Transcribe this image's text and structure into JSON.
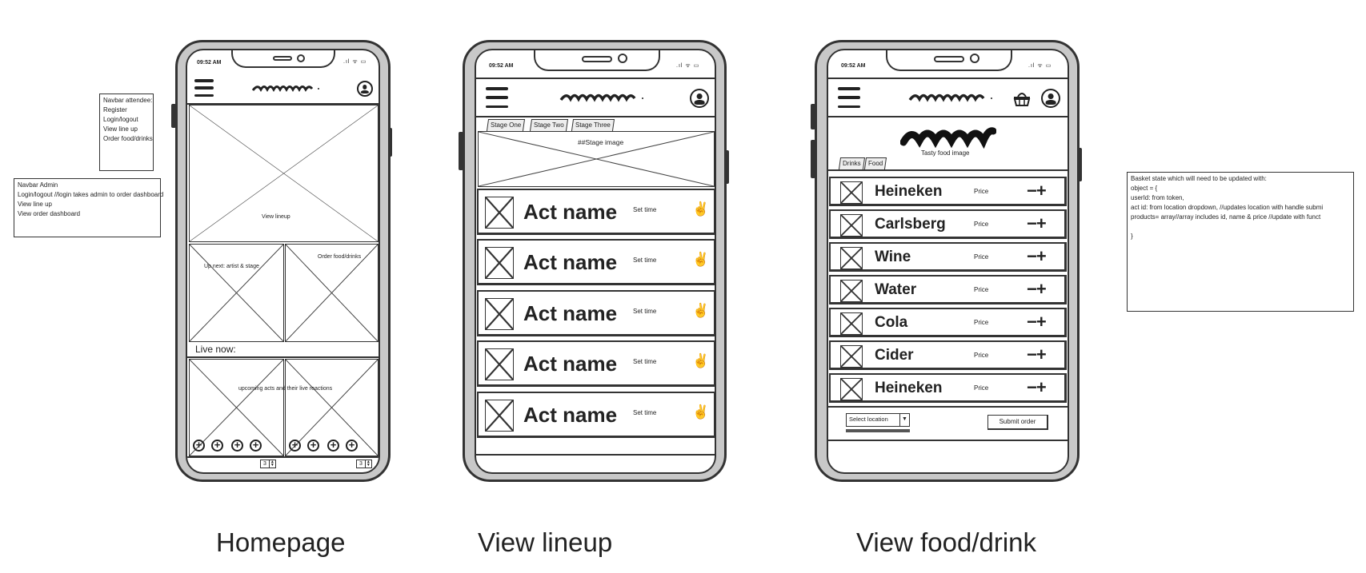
{
  "notes": {
    "navbar_attendee": [
      "Navbar attendee:",
      "Register",
      "Login/logout",
      "View line up",
      "Order food/drinks"
    ],
    "navbar_admin": [
      "Navbar Admin",
      "Login/logout //login takes admin to order dashboard",
      "View line up",
      "View order dashboard"
    ],
    "basket": [
      "Basket state which will need to be updated with:",
      "object = {",
      "userId: from token,",
      "act id: from location dropdown, //updates location with handle submi",
      "products= array//array includes id, name & price //update with funct",
      "",
      "}"
    ]
  },
  "status": {
    "time": "09:52 AM",
    "icons": ".ıl ᯤ ▭"
  },
  "homepage": {
    "caption": "Homepage",
    "hero_label": "View lineup",
    "upnext_label": "Up next: artist & stage",
    "order_label": "Order food/drinks",
    "live_now": "Live now:",
    "live_label": "upcoming acts and their live reactions",
    "plus": "+",
    "stepper_value": "3"
  },
  "lineup": {
    "caption": "View lineup",
    "tabs": [
      "Stage One",
      "Stage Two",
      "Stage Three"
    ],
    "stage_image": "##Stage image",
    "acts": [
      {
        "name": "Act name",
        "time": "Set time"
      },
      {
        "name": "Act name",
        "time": "Set time"
      },
      {
        "name": "Act name",
        "time": "Set time"
      },
      {
        "name": "Act name",
        "time": "Set time"
      },
      {
        "name": "Act name",
        "time": "Set time"
      }
    ],
    "reaction_icon": "✌"
  },
  "food": {
    "caption": "View food/drink",
    "hero_text": "Tasty food image",
    "tabs": [
      "Drinks",
      "Food"
    ],
    "items": [
      {
        "name": "Heineken",
        "price": "Price"
      },
      {
        "name": "Carlsberg",
        "price": "Price"
      },
      {
        "name": "Wine",
        "price": "Price"
      },
      {
        "name": "Water",
        "price": "Price"
      },
      {
        "name": "Cola",
        "price": "Price"
      },
      {
        "name": "Cider",
        "price": "Price"
      },
      {
        "name": "Heineken",
        "price": "Price"
      }
    ],
    "qty_controls": "−+",
    "select_location": "Select location",
    "submit": "Submit order"
  }
}
